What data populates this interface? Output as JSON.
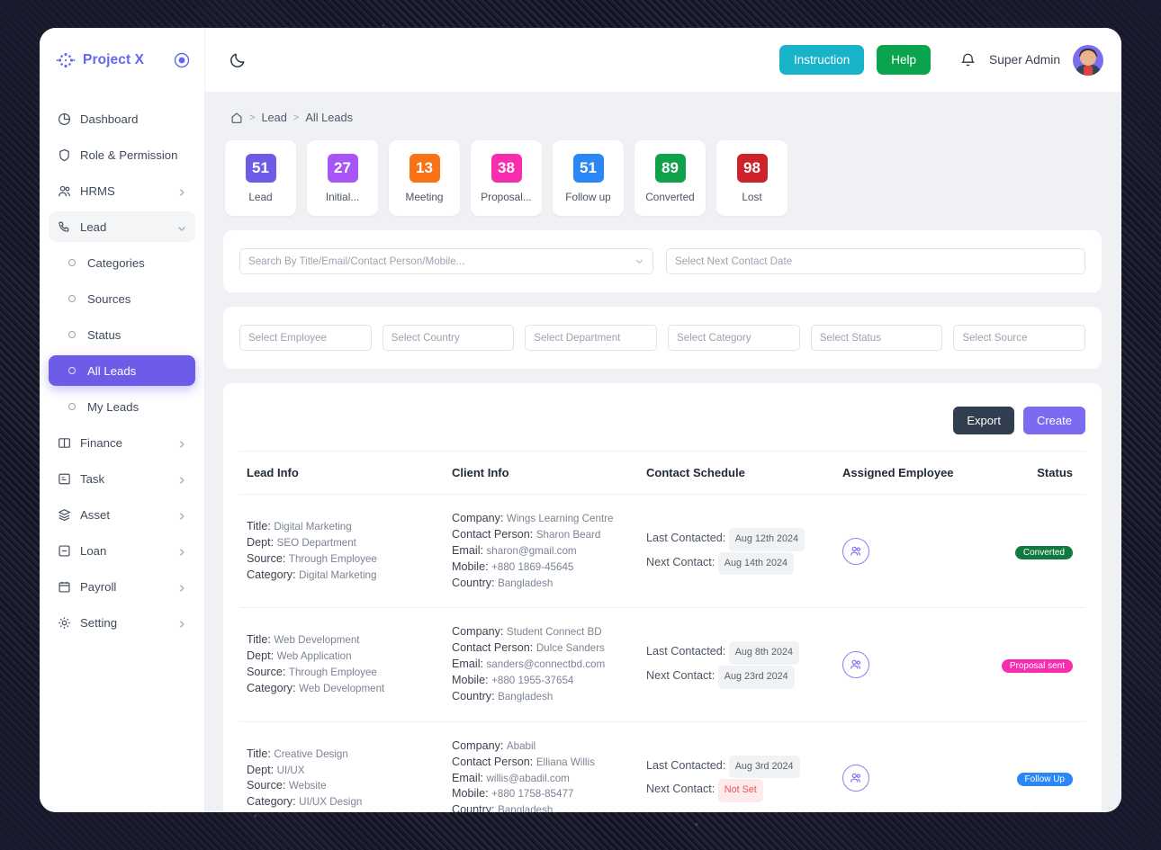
{
  "brand": {
    "name": "Project X",
    "logo_icon": "sparkle-dots-icon",
    "toggle_icon": "circle-target-icon"
  },
  "sidebar": {
    "items": [
      {
        "label": "Dashboard",
        "icon": "pie-chart-icon",
        "type": "link",
        "state": "normal"
      },
      {
        "label": "Role & Permission",
        "icon": "shield-icon",
        "type": "link",
        "state": "normal"
      },
      {
        "label": "HRMS",
        "icon": "users-icon",
        "type": "expandable",
        "state": "normal"
      },
      {
        "label": "Lead",
        "icon": "phone-icon",
        "type": "expandable",
        "state": "open"
      },
      {
        "label": "Categories",
        "icon": "circle-outline-icon",
        "type": "sub",
        "state": "normal"
      },
      {
        "label": "Sources",
        "icon": "circle-outline-icon",
        "type": "sub",
        "state": "normal"
      },
      {
        "label": "Status",
        "icon": "circle-outline-icon",
        "type": "sub",
        "state": "normal"
      },
      {
        "label": "All Leads",
        "icon": "circle-outline-icon",
        "type": "sub",
        "state": "active"
      },
      {
        "label": "My Leads",
        "icon": "circle-outline-icon",
        "type": "sub",
        "state": "normal"
      },
      {
        "label": "Finance",
        "icon": "book-icon",
        "type": "expandable",
        "state": "normal"
      },
      {
        "label": "Task",
        "icon": "task-board-icon",
        "type": "expandable",
        "state": "normal"
      },
      {
        "label": "Asset",
        "icon": "layers-icon",
        "type": "expandable",
        "state": "normal"
      },
      {
        "label": "Loan",
        "icon": "minus-square-icon",
        "type": "expandable",
        "state": "normal"
      },
      {
        "label": "Payroll",
        "icon": "calendar-icon",
        "type": "expandable",
        "state": "normal"
      },
      {
        "label": "Setting",
        "icon": "gear-icon",
        "type": "expandable",
        "state": "normal"
      }
    ]
  },
  "topbar": {
    "theme_toggle_icon": "moon-icon",
    "instruction_label": "Instruction",
    "help_label": "Help",
    "bell_icon": "bell-icon",
    "user_name": "Super Admin",
    "avatar_icon": "user-avatar",
    "colors": {
      "instruction": "#17b3c9",
      "help": "#0aa44f"
    }
  },
  "breadcrumb": {
    "home_icon": "home-icon",
    "items": [
      "Lead",
      "All Leads"
    ],
    "separator": ">"
  },
  "stats": [
    {
      "value": "51",
      "label": "Lead",
      "color": "#6c5ce7"
    },
    {
      "value": "27",
      "label": "Initial...",
      "color": "#a855f7"
    },
    {
      "value": "13",
      "label": "Meeting",
      "color": "#f97316"
    },
    {
      "value": "38",
      "label": "Proposal...",
      "color": "#f82dae"
    },
    {
      "value": "51",
      "label": "Follow up",
      "color": "#2b87f5"
    },
    {
      "value": "89",
      "label": "Converted",
      "color": "#12a14b"
    },
    {
      "value": "98",
      "label": "Lost",
      "color": "#cc2229"
    }
  ],
  "search": {
    "main_placeholder": "Search By Title/Email/Contact Person/Mobile...",
    "main_value": "",
    "date_placeholder": "Select Next Contact Date",
    "date_value": "",
    "dropdown_icon": "chevron-down-icon"
  },
  "filters": [
    {
      "placeholder": "Select Employee",
      "value": ""
    },
    {
      "placeholder": "Select Country",
      "value": ""
    },
    {
      "placeholder": "Select Department",
      "value": ""
    },
    {
      "placeholder": "Select Category",
      "value": ""
    },
    {
      "placeholder": "Select Status",
      "value": ""
    },
    {
      "placeholder": "Select Source",
      "value": ""
    }
  ],
  "table_actions": {
    "export_label": "Export",
    "create_label": "Create"
  },
  "table": {
    "columns": [
      "Lead Info",
      "Client Info",
      "Contact Schedule",
      "Assigned Employee",
      "Status"
    ],
    "labels": {
      "title": "Title:",
      "dept": "Dept:",
      "source": "Source:",
      "category": "Category:",
      "company": "Company:",
      "contact_person": "Contact Person:",
      "email": "Email:",
      "mobile": "Mobile:",
      "country": "Country:",
      "last_contacted": "Last Contacted:",
      "next_contact": "Next Contact:"
    },
    "employee_icon": "assigned-employee-icon",
    "rows": [
      {
        "lead": {
          "title": "Digital Marketing",
          "dept": "SEO Department",
          "source": "Through Employee",
          "category": "Digital Marketing"
        },
        "client": {
          "company": "Wings Learning Centre",
          "contact_person": "Sharon Beard",
          "email": "sharon@gmail.com",
          "mobile": "+880 1869-45645",
          "country": "Bangladesh"
        },
        "schedule": {
          "last_contacted": "Aug 12th 2024",
          "next_contact": "Aug 14th 2024",
          "next_not_set": false
        },
        "status": {
          "label": "Converted",
          "color": "#0f7a3d"
        }
      },
      {
        "lead": {
          "title": "Web Development",
          "dept": "Web Application",
          "source": "Through Employee",
          "category": "Web Development"
        },
        "client": {
          "company": "Student Connect BD",
          "contact_person": "Dulce Sanders",
          "email": "sanders@connectbd.com",
          "mobile": "+880 1955-37654",
          "country": "Bangladesh"
        },
        "schedule": {
          "last_contacted": "Aug 8th 2024",
          "next_contact": "Aug 23rd 2024",
          "next_not_set": false
        },
        "status": {
          "label": "Proposal sent",
          "color": "#f82dae"
        }
      },
      {
        "lead": {
          "title": "Creative Design",
          "dept": "UI/UX",
          "source": "Website",
          "category": "UI/UX Design"
        },
        "client": {
          "company": "Ababil",
          "contact_person": "Elliana Willis",
          "email": "willis@abadil.com",
          "mobile": "+880 1758-85477",
          "country": "Bangladesh"
        },
        "schedule": {
          "last_contacted": "Aug 3rd 2024",
          "next_contact": "Not Set",
          "next_not_set": true
        },
        "status": {
          "label": "Follow Up",
          "color": "#2b87f5"
        }
      }
    ]
  }
}
